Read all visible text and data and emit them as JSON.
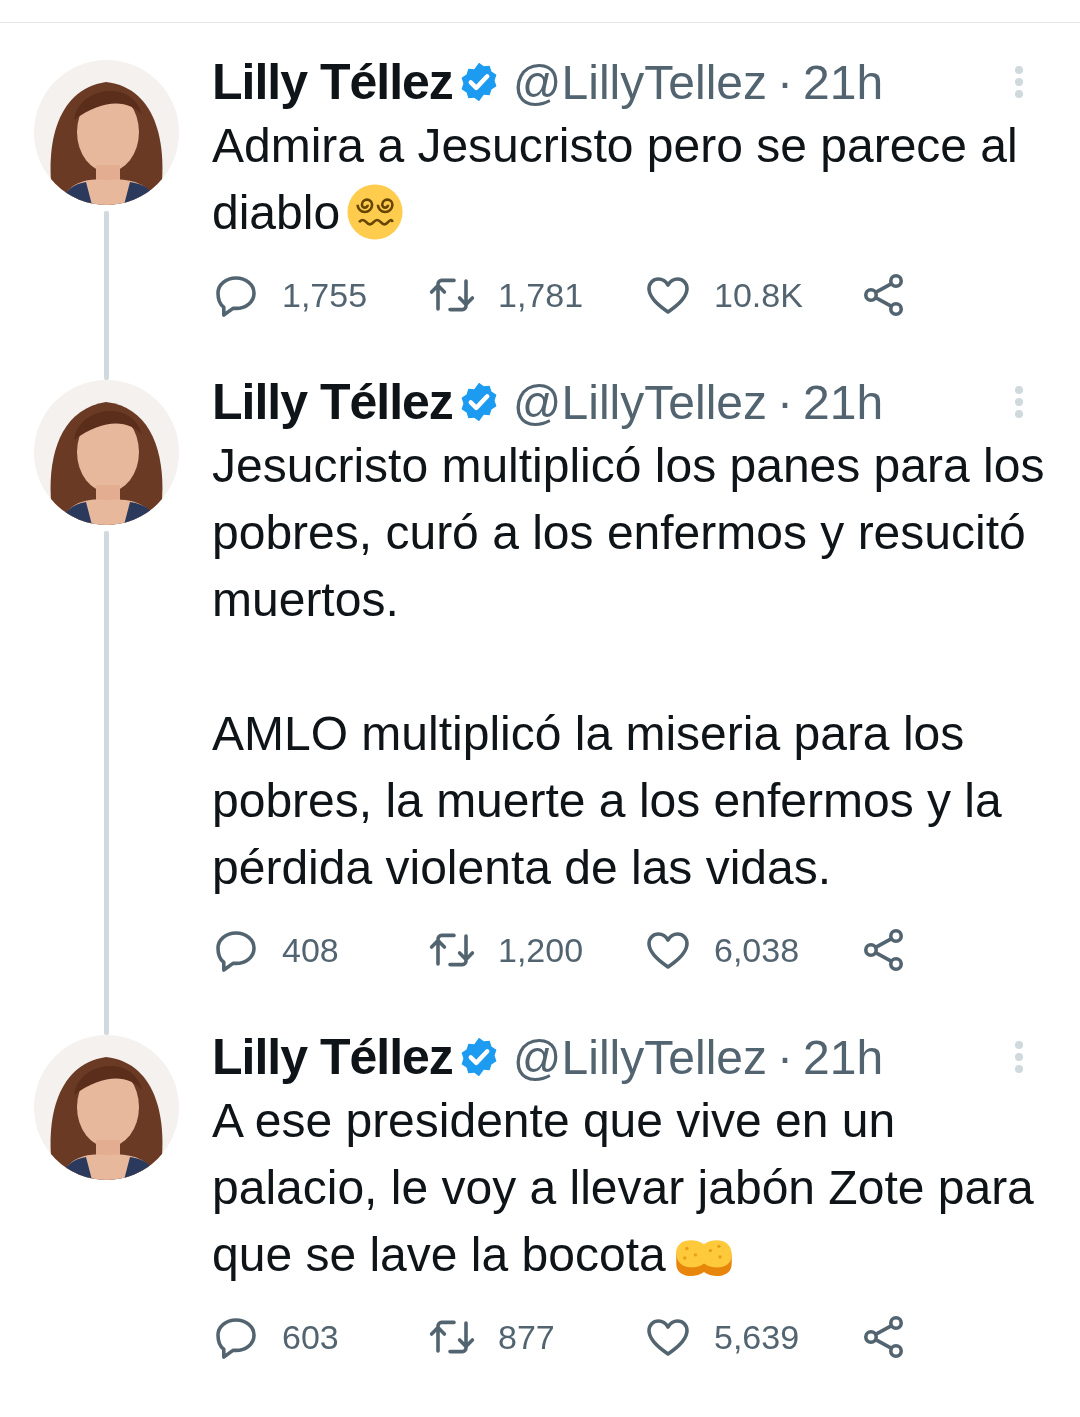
{
  "tweets": [
    {
      "name": "Lilly Téllez",
      "handle": "@LillyTellez",
      "time": "21h",
      "separator": "·",
      "verified": true,
      "thread_line": true,
      "paragraphs": [
        "Admira a Jesucristo pero se parece al diablo"
      ],
      "trailing_emoji": {
        "kind": "dizzy-face"
      },
      "replies": "1,755",
      "retweets": "1,781",
      "likes": "10.8K"
    },
    {
      "name": "Lilly Téllez",
      "handle": "@LillyTellez",
      "time": "21h",
      "separator": "·",
      "verified": true,
      "thread_line": true,
      "paragraphs": [
        "Jesucristo multiplicó los panes para los pobres, curó a los enfermos y resucitó muertos.",
        "AMLO multiplicó la miseria para los pobres, la muerte a los enfermos y la pérdida violenta de las vidas."
      ],
      "replies": "408",
      "retweets": "1,200",
      "likes": "6,038"
    },
    {
      "name": "Lilly Téllez",
      "handle": "@LillyTellez",
      "time": "21h",
      "separator": "·",
      "verified": true,
      "thread_line": false,
      "paragraphs": [
        "A ese presidente que vive en un palacio, le voy a llevar jabón Zote para que se lave la bocota"
      ],
      "trailing_emoji": {
        "kind": "sponge"
      },
      "replies": "603",
      "retweets": "877",
      "likes": "5,639"
    }
  ]
}
